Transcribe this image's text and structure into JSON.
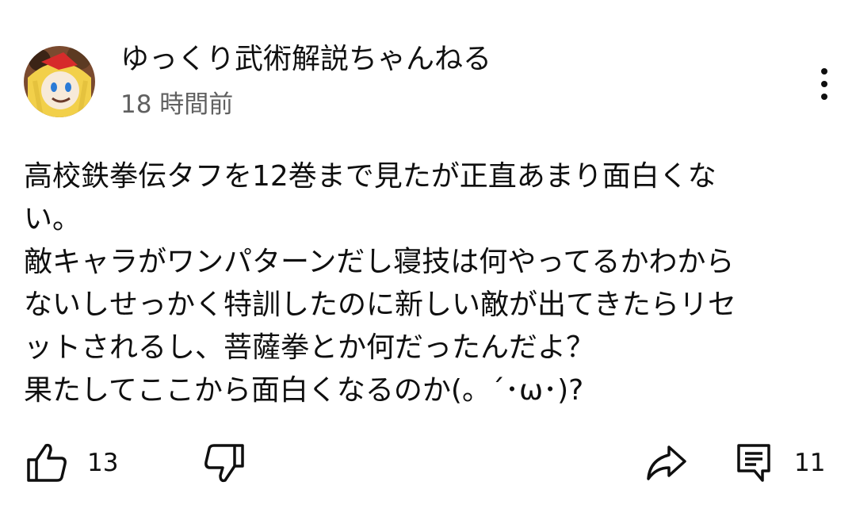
{
  "comment": {
    "author": "ゆっくり武術解説ちゃんねる",
    "time": "18 時間前",
    "text_lines": [
      "高校鉄拳伝タフを12巻まで見たが正直あまり面白くな",
      "い。",
      "敵キャラがワンパターンだし寝技は何やってるかわから",
      "ないしせっかく特訓したのに新しい敵が出てきたらリセ",
      "ットされるし、菩薩拳とか何だったんだよ？",
      "果たしてここから面白くなるのか(。´･ω･)?"
    ]
  },
  "actions": {
    "like_count": "13",
    "reply_count": "11",
    "icons": [
      "thumbs-up-icon",
      "thumbs-down-icon",
      "share-icon",
      "reply-icon",
      "more-vert-icon"
    ]
  },
  "colors": {
    "text": "#0f0f0f",
    "secondary": "#606060",
    "background": "#ffffff"
  }
}
